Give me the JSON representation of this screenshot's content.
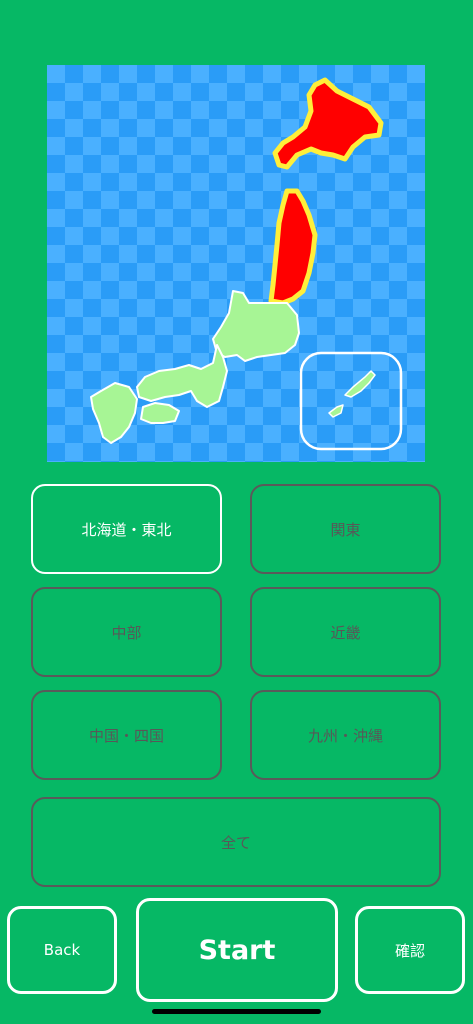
{
  "map": {
    "background_colors": [
      "#2a9cf7",
      "#4ab0ff"
    ],
    "selected_region_color": "#ff0000",
    "selected_outline_color": "#ffef3a",
    "unselected_region_color": "#a7f595",
    "selected_regions": [
      "北海道・東北"
    ]
  },
  "regions": [
    {
      "label": "北海道・東北",
      "selected": true
    },
    {
      "label": "関東",
      "selected": false
    },
    {
      "label": "中部",
      "selected": false
    },
    {
      "label": "近畿",
      "selected": false
    },
    {
      "label": "中国・四国",
      "selected": false
    },
    {
      "label": "九州・沖縄",
      "selected": false
    }
  ],
  "all_label": "全て",
  "footer": {
    "back_label": "Back",
    "start_label": "Start",
    "confirm_label": "確認"
  }
}
